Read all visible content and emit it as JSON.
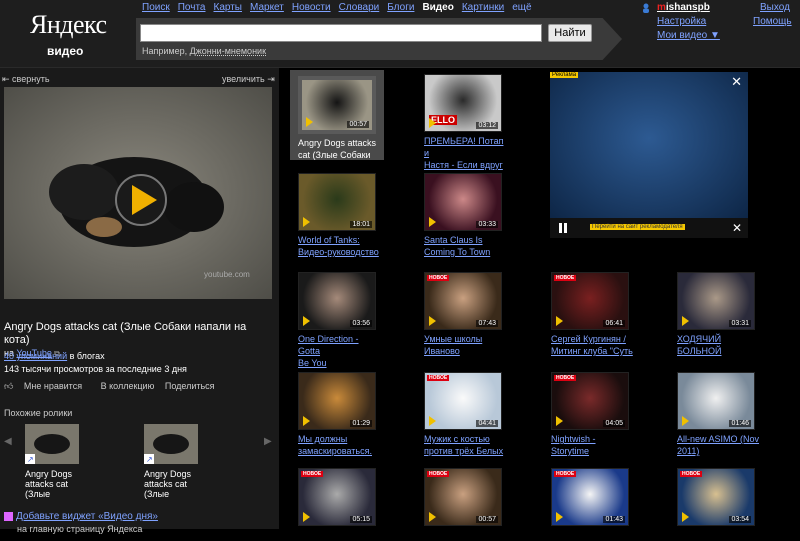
{
  "header": {
    "logo": "Яндекс",
    "logo_sub": "видео",
    "services": [
      "Поиск",
      "Почта",
      "Карты",
      "Маркет",
      "Новости",
      "Словари",
      "Блоги"
    ],
    "current_service": "Видео",
    "services_after": [
      "Картинки"
    ],
    "more": "ещё",
    "search_value": "",
    "search_button": "Найти",
    "example_prefix": "Например, ",
    "example_link": "Джонни-мнемоник",
    "user_first": "m",
    "user_rest": "ishanspb",
    "settings": "Настройка",
    "my_video": "Мои видео ▼",
    "exit": "Выход",
    "help": "Помощь"
  },
  "player": {
    "collapse": "⇤ свернуть",
    "enlarge": "увеличить ⇥",
    "watermark": "youtube.com"
  },
  "video": {
    "title": "Angry Dogs attacks cat (Злые Собаки напали на кота)",
    "source_prefix": "на ",
    "source": "YouTube",
    "mentions_link": "40 упоминаний",
    "mentions_suffix": " в блогах",
    "views": "143 тысячи просмотров за последние 3 дня",
    "like": "Мне нравится",
    "collection": "В коллекцию",
    "share": "Поделиться"
  },
  "similar": {
    "title": "Похожие ролики",
    "items": [
      {
        "line1": "Angry Dogs",
        "line2": "attacks cat",
        "line3": "(Злые"
      },
      {
        "line1": "Angry Dogs",
        "line2": "attacks cat",
        "line3": "(Злые"
      }
    ]
  },
  "widget": {
    "link": "Добавьте виджет «Видео дня»",
    "sub": "на главную страницу Яндекса"
  },
  "ad": {
    "label": "Реклама",
    "link": "Перейти на сайт рекламодателя"
  },
  "results": [
    {
      "duration": "00:57",
      "title1": "Angry Dogs attacks",
      "title2": "cat (Злые Собаки",
      "new": ""
    },
    {
      "duration": "03:12",
      "title1": "ПРЕМЬЕРА! Потап и",
      "title2": "Настя - Если вдруг",
      "new": "",
      "overlay": "ELLO"
    },
    {
      "duration": "18:01",
      "title1": "World of Tanks:",
      "title2": "Видео-руководство",
      "new": ""
    },
    {
      "duration": "03:33",
      "title1": "Santa Claus Is",
      "title2": "Coming To Town",
      "new": ""
    },
    {
      "duration": "03:56",
      "title1": "One Direction - Gotta",
      "title2": "Be You",
      "new": ""
    },
    {
      "duration": "07:43",
      "title1": "Умные школы",
      "title2": "Иваново",
      "new": "НОВОЕ"
    },
    {
      "duration": "06:41",
      "title1": "Сергей Кургинян /",
      "title2": "Митинг клуба \"Суть",
      "new": "НОВОЕ"
    },
    {
      "duration": "03:31",
      "title1": "ХОДЯЧИЙ БОЛЬНОЙ",
      "title2": "",
      "new": ""
    },
    {
      "duration": "01:29",
      "title1": "Мы должны",
      "title2": "замаскироваться.",
      "new": ""
    },
    {
      "duration": "04:41",
      "title1": "Мужик с костью",
      "title2": "против трёх Белых",
      "new": "НОВОЕ"
    },
    {
      "duration": "04:05",
      "title1": "Nightwish - Storytime",
      "title2": "",
      "new": "НОВОЕ"
    },
    {
      "duration": "01:46",
      "title1": "All-new ASIMO (Nov",
      "title2": "2011)",
      "new": ""
    },
    {
      "duration": "05:15",
      "title1": "",
      "title2": "",
      "new": "НОВОЕ"
    },
    {
      "duration": "00:57",
      "title1": "",
      "title2": "",
      "new": "НОВОЕ"
    },
    {
      "duration": "01:43",
      "title1": "",
      "title2": "",
      "new": "НОВОЕ"
    },
    {
      "duration": "03:54",
      "title1": "",
      "title2": "",
      "new": "НОВОЕ"
    }
  ]
}
